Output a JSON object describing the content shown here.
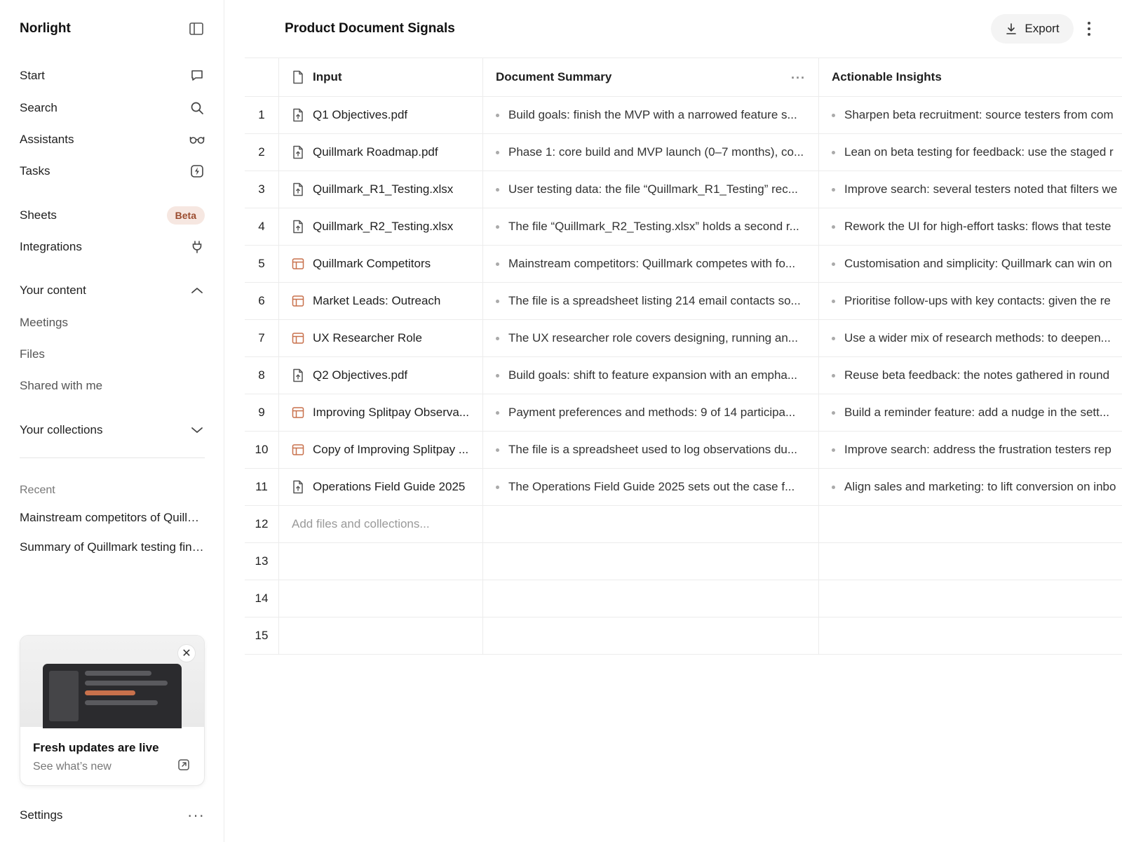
{
  "sidebar": {
    "brand": "Norlight",
    "nav": [
      {
        "label": "Start",
        "icon": "chat-bubble-icon"
      },
      {
        "label": "Search",
        "icon": "search-icon"
      },
      {
        "label": "Assistants",
        "icon": "glasses-icon"
      },
      {
        "label": "Tasks",
        "icon": "lightning-icon"
      },
      {
        "label": "Sheets",
        "badge": "Beta"
      },
      {
        "label": "Integrations",
        "icon": "plug-icon"
      }
    ],
    "your_content": {
      "label": "Your content",
      "items": [
        "Meetings",
        "Files",
        "Shared with me"
      ]
    },
    "your_collections": {
      "label": "Your collections"
    },
    "recent": {
      "label": "Recent",
      "items": [
        "Mainstream competitors of Quillmark",
        "Summary of Quillmark testing findings"
      ]
    },
    "update_card": {
      "title": "Fresh updates are live",
      "subtitle": "See what’s new",
      "close": "✕",
      "accent": "#c8714c"
    },
    "settings": {
      "label": "Settings",
      "more": "···"
    }
  },
  "header": {
    "title": "Product Document Signals",
    "export_label": "Export"
  },
  "table": {
    "columns": {
      "input": "Input",
      "summary": "Document Summary",
      "insights": "Actionable Insights",
      "menu": "···"
    },
    "rows": [
      {
        "num": "1",
        "type": "pdf",
        "input": "Q1 Objectives.pdf",
        "summary": "Build goals: finish the MVP with a narrowed feature s...",
        "insight": "Sharpen beta recruitment: source testers from com"
      },
      {
        "num": "2",
        "type": "pdf",
        "input": "Quillmark Roadmap.pdf",
        "summary": "Phase 1: core build and MVP launch (0–7 months), co...",
        "insight": "Lean on beta testing for feedback: use the staged r"
      },
      {
        "num": "3",
        "type": "pdf",
        "input": "Quillmark_R1_Testing.xlsx",
        "summary": "User testing data: the file “Quillmark_R1_Testing” rec...",
        "insight": "Improve search: several testers noted that filters we"
      },
      {
        "num": "4",
        "type": "pdf",
        "input": "Quillmark_R2_Testing.xlsx",
        "summary": "The file “Quillmark_R2_Testing.xlsx” holds a second r...",
        "insight": "Rework the UI for high-effort tasks: flows that teste"
      },
      {
        "num": "5",
        "type": "table",
        "input": "Quillmark Competitors",
        "summary": "Mainstream competitors: Quillmark competes with fo...",
        "insight": "Customisation and simplicity: Quillmark can win on"
      },
      {
        "num": "6",
        "type": "table",
        "input": "Market Leads: Outreach",
        "summary": "The file is a spreadsheet listing 214 email contacts so...",
        "insight": "Prioritise follow-ups with key contacts: given the re"
      },
      {
        "num": "7",
        "type": "table",
        "input": "UX Researcher Role",
        "summary": "The UX researcher role covers designing, running an...",
        "insight": "Use a wider mix of research methods: to deepen..."
      },
      {
        "num": "8",
        "type": "pdf",
        "input": "Q2 Objectives.pdf",
        "summary": "Build goals: shift to feature expansion with an empha...",
        "insight": "Reuse beta feedback: the notes gathered in round"
      },
      {
        "num": "9",
        "type": "table",
        "input": "Improving Splitpay Observa...",
        "summary": "Payment preferences and methods: 9 of 14 participa...",
        "insight": "Build a reminder feature: add a nudge in the sett..."
      },
      {
        "num": "10",
        "type": "table",
        "input": "Copy of Improving Splitpay ...",
        "summary": "The file is a spreadsheet used to log observations du...",
        "insight": "Improve search: address the frustration testers rep"
      },
      {
        "num": "11",
        "type": "pdf",
        "input": "Operations Field Guide 2025",
        "summary": "The Operations Field Guide 2025 sets out the case f...",
        "insight": "Align sales and marketing: to lift conversion on inbo"
      }
    ],
    "add_placeholder": "Add files and collections...",
    "empty_rows": [
      "12",
      "13",
      "14",
      "15"
    ]
  },
  "colors": {
    "accent": "#c8714c",
    "border": "#ececec",
    "muted": "#777777",
    "badge_bg": "#f6e7e1",
    "badge_fg": "#9b4c2f"
  }
}
